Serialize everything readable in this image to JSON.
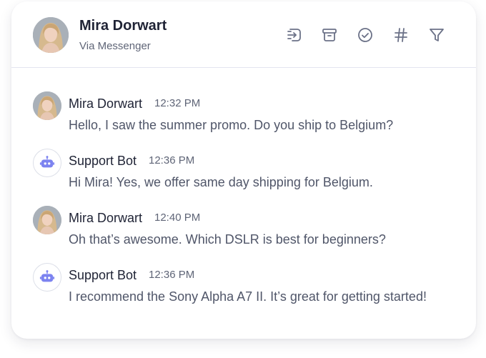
{
  "header": {
    "name": "Mira Dorwart",
    "channel": "Via Messenger",
    "icons": [
      "assign-icon",
      "archive-icon",
      "resolve-check-icon",
      "hashtag-icon",
      "filter-icon"
    ]
  },
  "messages": [
    {
      "sender": "Mira Dorwart",
      "time": "12:32 PM",
      "text": "Hello, I saw the summer promo. Do you ship to Belgium?",
      "avatar": "user-photo"
    },
    {
      "sender": "Support Bot",
      "time": "12:36 PM",
      "text": "Hi Mira! Yes, we offer same day shipping for Belgium.",
      "avatar": "bot-icon"
    },
    {
      "sender": "Mira Dorwart",
      "time": "12:40 PM",
      "text": "Oh that’s awesome. Which DSLR is best for beginners?",
      "avatar": "user-photo"
    },
    {
      "sender": "Support Bot",
      "time": "12:36 PM",
      "text": "I recommend the Sony Alpha A7 II. It’s great for getting started!",
      "avatar": "bot-icon"
    }
  ],
  "colors": {
    "title": "#1f2335",
    "muted": "#5f6577",
    "body": "#505669",
    "icon": "#6b7187",
    "bot_accent": "#7c83f0",
    "divider": "#e3e5ef"
  }
}
